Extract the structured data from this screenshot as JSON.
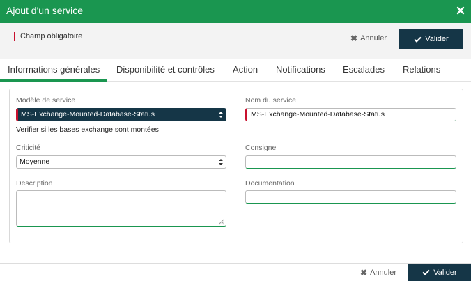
{
  "dialog": {
    "title": "Ajout d'un service"
  },
  "required_note": "Champ obligatoire",
  "actions": {
    "cancel_label": "Annuler",
    "submit_label": "Valider"
  },
  "tabs": [
    {
      "label": "Informations générales"
    },
    {
      "label": "Disponibilité et contrôles"
    },
    {
      "label": "Action"
    },
    {
      "label": "Notifications"
    },
    {
      "label": "Escalades"
    },
    {
      "label": "Relations"
    }
  ],
  "form": {
    "service_model": {
      "label": "Modèle de service",
      "value": "MS-Exchange-Mounted-Database-Status",
      "hint": "Verifier si les bases exchange sont montées"
    },
    "service_name": {
      "label": "Nom du service",
      "value": "MS-Exchange-Mounted-Database-Status"
    },
    "criticality": {
      "label": "Criticité",
      "value": "Moyenne"
    },
    "instruction": {
      "label": "Consigne",
      "value": ""
    },
    "description": {
      "label": "Description",
      "value": ""
    },
    "documentation": {
      "label": "Documentation",
      "value": ""
    }
  },
  "colors": {
    "header": "#1a9650",
    "primary_button": "#153647",
    "required_marker": "#c8102e"
  }
}
